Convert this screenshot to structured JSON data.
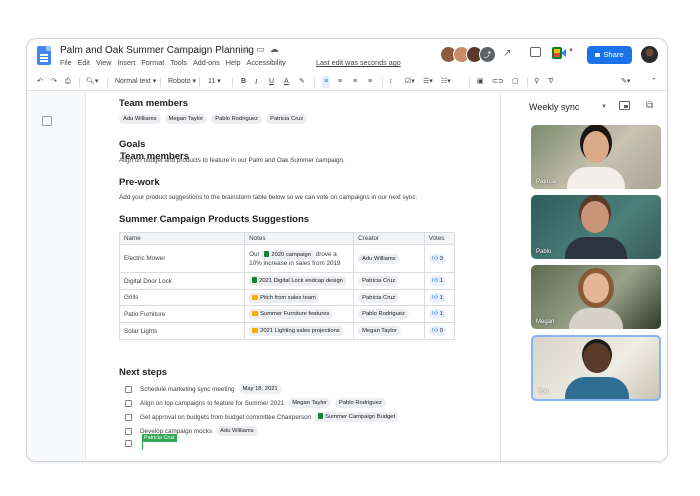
{
  "doc": {
    "title": "Palm and Oak Summer Campaign Planning",
    "menu": [
      "File",
      "Edit",
      "View",
      "Insert",
      "Format",
      "Tools",
      "Add-ons",
      "Help",
      "Accessibility"
    ],
    "last_edit": "Last edit was seconds ago",
    "share_label": "Share",
    "avatar_more": "⤴"
  },
  "toolbar": {
    "zoom": "",
    "style": "Normal text",
    "font": "Roboto",
    "size": "11"
  },
  "content": {
    "team_heading": "Team members",
    "team": [
      "Adu Williams",
      "Megan Taylor",
      "Pablo Rodriguez",
      "Patricia Cruz"
    ],
    "goals_heading": "Goals",
    "goals_text": "Align on budget and products to feature in our Palm and Oak Summer campaign.",
    "prework_heading": "Pre-work",
    "prework_text": "Add your product suggestions to the brainstorm table below so we can vote on campaigns in our next sync.",
    "table_heading": "Summer Campaign Products Suggestions",
    "table_headers": [
      "Name",
      "Notes",
      "Creator",
      "Votes"
    ],
    "rows": [
      {
        "name": "Electric Mower",
        "note_pre": "Our",
        "note_chip": "2020 campaign",
        "note_post": "drove a",
        "note_line2": "10% increase in sales from 2019",
        "creator": "Adu Williams",
        "votes": "3"
      },
      {
        "name": "Digital Door Lock",
        "note_chip": "2021 Digital Lock endcap design",
        "creator": "Patricia Cruz",
        "votes": "1"
      },
      {
        "name": "Grills",
        "note_chip": "Pitch from sales team",
        "creator": "Patricia Cruz",
        "votes": "1"
      },
      {
        "name": "Patio Furniture",
        "note_chip": "Summer Furniture features",
        "creator": "Pablo Rodriguez",
        "votes": "1"
      },
      {
        "name": "Solar Lights",
        "note_chip": "2021 Lighting sales projections",
        "creator": "Megan Taylor",
        "votes": "0"
      }
    ],
    "next_heading": "Next steps",
    "tasks": [
      {
        "text": "Schedule marketing sync meeting",
        "chips": [
          "May 18, 2021"
        ]
      },
      {
        "text": "Align on top campaigns to feature for Summer 2021",
        "chips": [
          "Megan Taylor",
          "Pablo Rodriguez"
        ]
      },
      {
        "text": "Get approval on budgets from budget committee Chairperson",
        "chips": [
          "Summer Campaign Budget"
        ]
      },
      {
        "text": "Develop campaign mocks",
        "chips": [
          "Adu Williams"
        ]
      },
      {
        "text": "",
        "chips": []
      }
    ],
    "cursor_user": "Patricia Cruz"
  },
  "meet": {
    "title": "Weekly sync",
    "participants": [
      "Patricia",
      "Pablo",
      "Megan",
      "You"
    ]
  },
  "colors": {
    "accent": "#1a73e8",
    "hangup": "#ea4335",
    "cursor": "#34a853"
  }
}
